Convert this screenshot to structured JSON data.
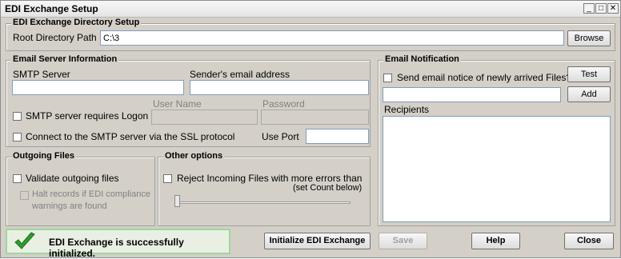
{
  "window": {
    "title": "EDI Exchange Setup",
    "controls": {
      "minimize": "_",
      "maximize": "□",
      "close": "✕"
    }
  },
  "directory": {
    "group_label": "EDI Exchange Directory Setup",
    "root_label": "Root Directory Path",
    "root_value": "C:\\3",
    "browse_label": "Browse"
  },
  "email_server": {
    "group_label": "Email Server Information",
    "smtp_label": "SMTP Server",
    "smtp_value": "",
    "sender_label": "Sender's email address",
    "sender_value": "",
    "logon_label": "SMTP server requires Logon",
    "username_label": "User Name",
    "username_value": "",
    "password_label": "Password",
    "password_value": "",
    "ssl_label": "Connect to the SMTP server via the SSL protocol",
    "port_label": "Use Port",
    "port_value": ""
  },
  "notification": {
    "group_label": "Email Notification",
    "send_notice_label": "Send email notice of newly arrived Files?",
    "test_label": "Test",
    "add_label": "Add",
    "new_recipient_value": "",
    "recipients_label": "Recipients"
  },
  "outgoing": {
    "group_label": "Outgoing Files",
    "validate_label": "Validate outgoing files",
    "halt_label_line1": "Halt records if EDI compliance",
    "halt_label_line2": "warnings are found"
  },
  "other": {
    "group_label": "Other options",
    "reject_label": "Reject Incoming Files with more errors than",
    "reject_sub_label": "(set Count below)",
    "error_count_level": 0
  },
  "status": {
    "message": "EDI Exchange is successfully initialized.",
    "icon": "checkmark-icon",
    "color": "#2e9e2e"
  },
  "footer": {
    "initialize_label": "Initialize EDI Exchange",
    "save_label": "Save",
    "help_label": "Help",
    "close_label": "Close"
  }
}
